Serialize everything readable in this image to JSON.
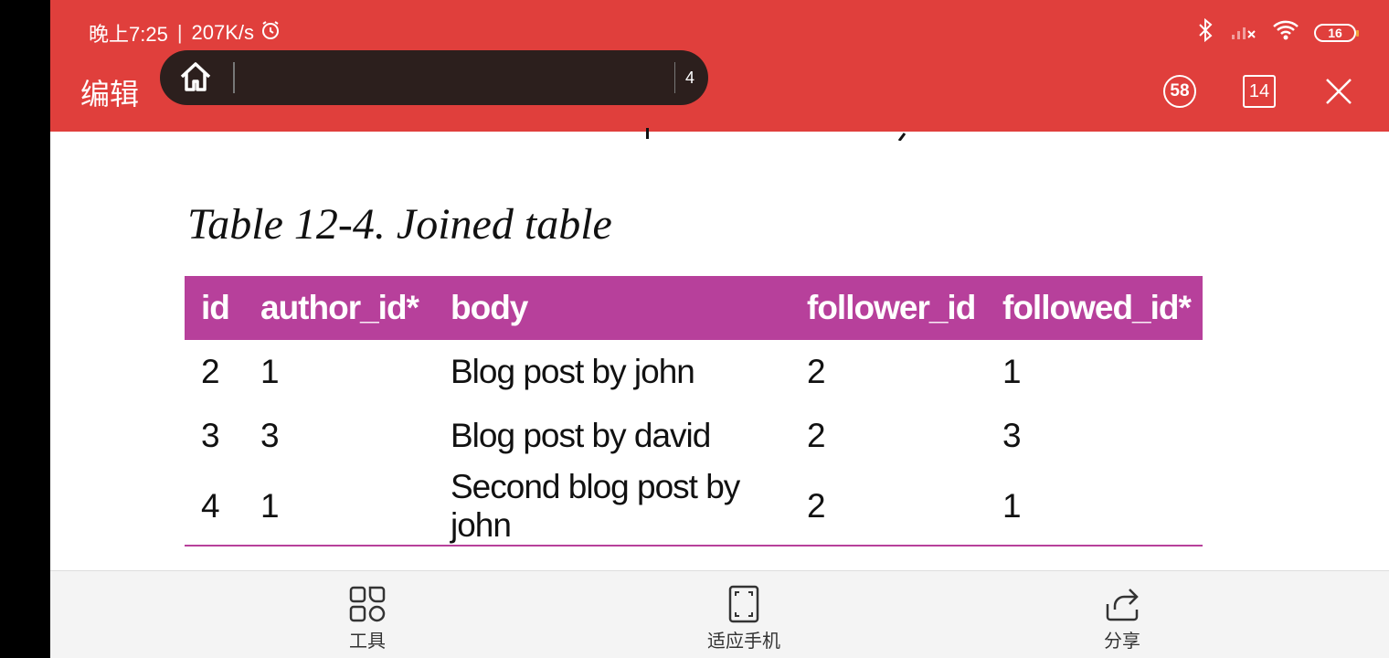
{
  "status_bar": {
    "time": "晚上7:25",
    "speed": "207K/s",
    "battery": "16"
  },
  "toolbar": {
    "edit_label": "编辑",
    "tab_count": "4",
    "badge_58": "58",
    "badge_14": "14"
  },
  "document": {
    "table_title": "Table 12-4. Joined table",
    "table": {
      "headers": [
        "id",
        "author_id*",
        "body",
        "follower_id",
        "followed_id*"
      ],
      "rows": [
        [
          "2",
          "1",
          "Blog post by john",
          "2",
          "1"
        ],
        [
          "3",
          "3",
          "Blog post by david",
          "2",
          "3"
        ],
        [
          "4",
          "1",
          "Second blog post by john",
          "2",
          "1"
        ]
      ]
    }
  },
  "bottom_bar": {
    "tools": "工具",
    "fit_phone": "适应手机",
    "share": "分享"
  },
  "colors": {
    "topbar": "#e03f3c",
    "table_header": "#b7409b",
    "searchbar": "#2c1f1d"
  }
}
